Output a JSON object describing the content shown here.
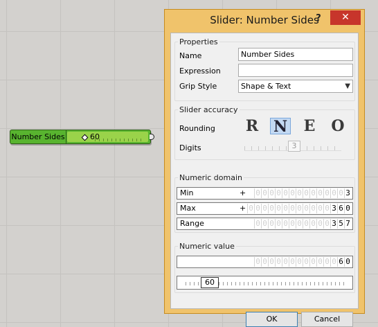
{
  "canvas": {
    "component": {
      "label": "Number Sides",
      "value": "60"
    }
  },
  "dialog": {
    "title": "Slider: Number Sides",
    "help": "?",
    "close": "✕",
    "properties": {
      "title": "Properties",
      "name_label": "Name",
      "name_value": "Number Sides",
      "expression_label": "Expression",
      "expression_value": "",
      "grip_label": "Grip Style",
      "grip_value": "Shape & Text"
    },
    "accuracy": {
      "title": "Slider accuracy",
      "rounding_label": "Rounding",
      "options": [
        "R",
        "N",
        "E",
        "O"
      ],
      "selected": "N",
      "digits_label": "Digits",
      "digits_value": "3"
    },
    "domain": {
      "title": "Numeric domain",
      "min_label": "Min",
      "min_sign": "+",
      "min_digits": [
        "0",
        "0",
        "0",
        "0",
        "0",
        "0",
        "0",
        "0",
        "0",
        "0",
        "0",
        "0",
        "0",
        "3"
      ],
      "max_label": "Max",
      "max_sign": "+",
      "max_digits": [
        "0",
        "0",
        "0",
        "0",
        "0",
        "0",
        "0",
        "0",
        "0",
        "0",
        "0",
        "0",
        "3",
        "6",
        "0"
      ],
      "range_label": "Range",
      "range_digits": [
        "0",
        "0",
        "0",
        "0",
        "0",
        "0",
        "0",
        "0",
        "0",
        "0",
        "0",
        "3",
        "5",
        "7"
      ]
    },
    "value": {
      "title": "Numeric value",
      "digits": [
        "0",
        "0",
        "0",
        "0",
        "0",
        "0",
        "0",
        "0",
        "0",
        "0",
        "0",
        "0",
        "6",
        "0"
      ],
      "slider_value": "60"
    },
    "ok_label": "OK",
    "cancel_label": "Cancel"
  }
}
